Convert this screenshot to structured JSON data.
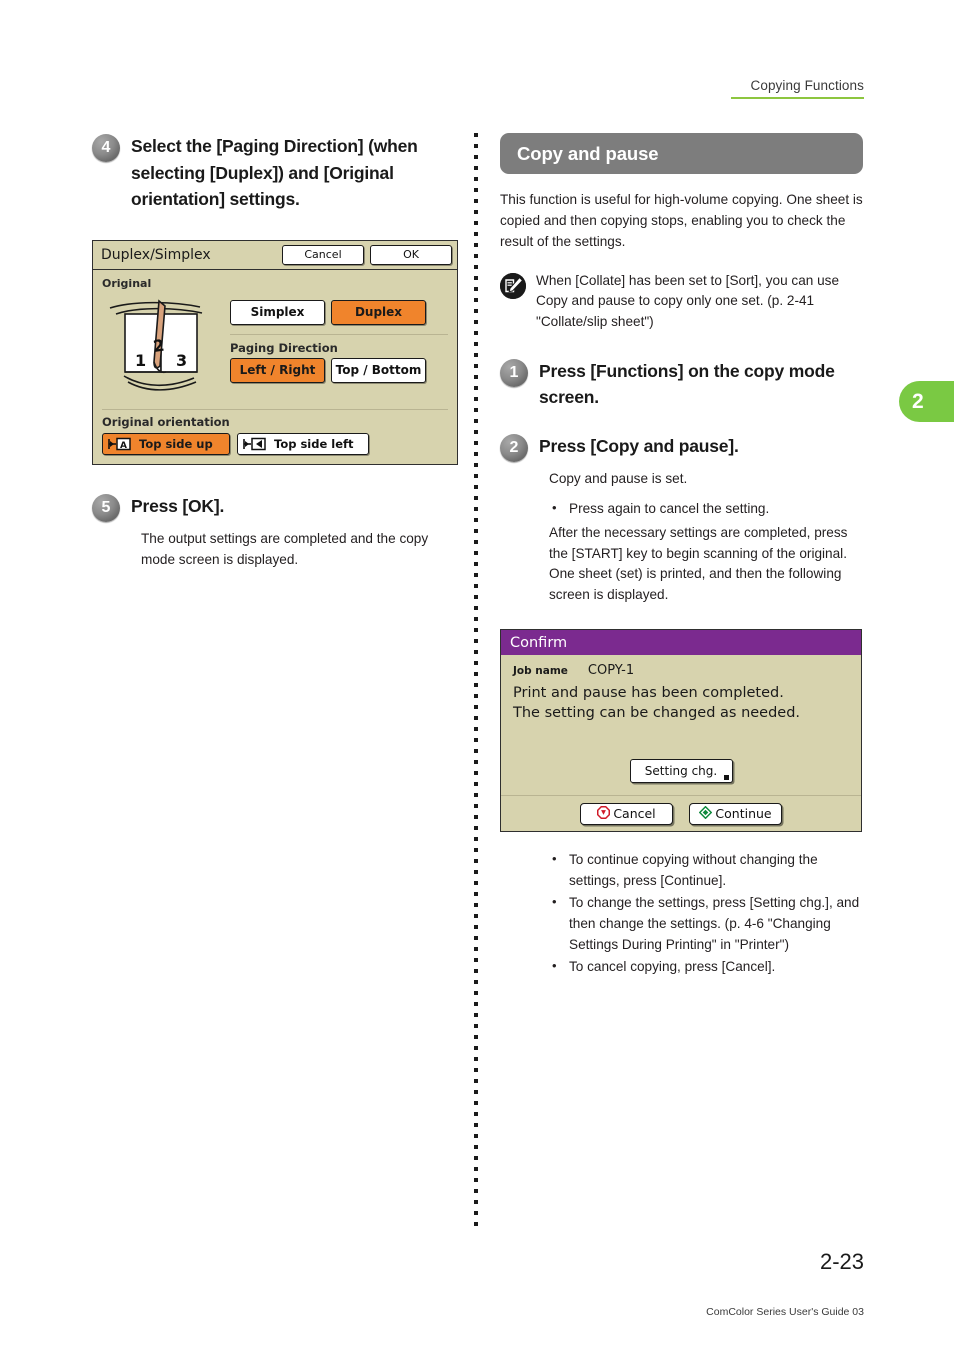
{
  "header": {
    "running_title": "Copying Functions",
    "accent_color": "#8dc63f"
  },
  "chapter_tab": {
    "number": "2",
    "color": "#7ac943"
  },
  "left_column": {
    "step4": {
      "number": "4",
      "title": "Select the [Paging Direction] (when selecting [Duplex]) and [Original orientation] settings."
    },
    "duplex_panel": {
      "title": "Duplex/Simplex",
      "cancel_label": "Cancel",
      "ok_label": "OK",
      "original_label": "Original",
      "mode_buttons": [
        {
          "label": "Simplex",
          "selected": false
        },
        {
          "label": "Duplex",
          "selected": true
        }
      ],
      "paging_direction_label": "Paging Direction",
      "paging_buttons": [
        {
          "label": "Left / Right",
          "selected": true
        },
        {
          "label": "Top / Bottom",
          "selected": false
        }
      ],
      "original_orientation_label": "Original orientation",
      "orientation_buttons": [
        {
          "label": "Top side up",
          "glyph": "top-side-up-icon",
          "selected": true
        },
        {
          "label": "Top side left",
          "glyph": "top-side-left-icon",
          "selected": false
        }
      ],
      "illustration": {
        "name": "duplex-page-turn-illustration",
        "page_numbers": [
          "1",
          "2",
          "3"
        ]
      },
      "selected_color": "#f0842c",
      "panel_background": "#d7d3ae"
    },
    "step5": {
      "number": "5",
      "title": "Press [OK].",
      "body": "The output settings are completed and the copy mode screen is displayed."
    }
  },
  "right_column": {
    "section_title": "Copy and pause",
    "section_banner_color": "#7d7d7d",
    "intro": "This function is useful for high-volume copying. One sheet is copied and then copying stops, enabling you to check the result of the settings.",
    "note": {
      "icon": "memo-pencil-icon",
      "text": "When [Collate] has been set to [Sort], you can use Copy and pause to copy only one set. (p. 2-41 \"Collate/slip sheet\")"
    },
    "step1": {
      "number": "1",
      "title": "Press [Functions] on the copy mode screen."
    },
    "step2": {
      "number": "2",
      "title": "Press [Copy and pause].",
      "body_1": "Copy and pause is set.",
      "bullets": [
        "Press again to cancel the setting."
      ],
      "body_2": "After the necessary settings are completed, press the [START] key to begin scanning of the original. One sheet (set) is printed, and then the following screen is displayed."
    },
    "confirm_dialog": {
      "title": "Confirm",
      "titlebar_color": "#7b2a8f",
      "job_name_label": "Job name",
      "job_name_value": "COPY-1",
      "message_line_1": "Print and pause has been completed.",
      "message_line_2": "The setting can be changed as needed.",
      "setting_chg_label": "Setting chg.",
      "cancel_label": "Cancel",
      "continue_label": "Continue",
      "cancel_icon": "stop-octagon-icon",
      "continue_icon": "green-diamond-icon",
      "panel_background": "#d7d3ae"
    },
    "final_bullets": [
      "To continue copying without changing the settings, press [Continue].",
      "To change the settings, press [Setting chg.], and then change the settings. (p. 4-6 \"Changing Settings During Printing\" in \"Printer\")",
      "To cancel copying, press [Cancel]."
    ]
  },
  "footer": {
    "page_number": "2-23",
    "guide_text": "ComColor Series User's Guide 03"
  }
}
